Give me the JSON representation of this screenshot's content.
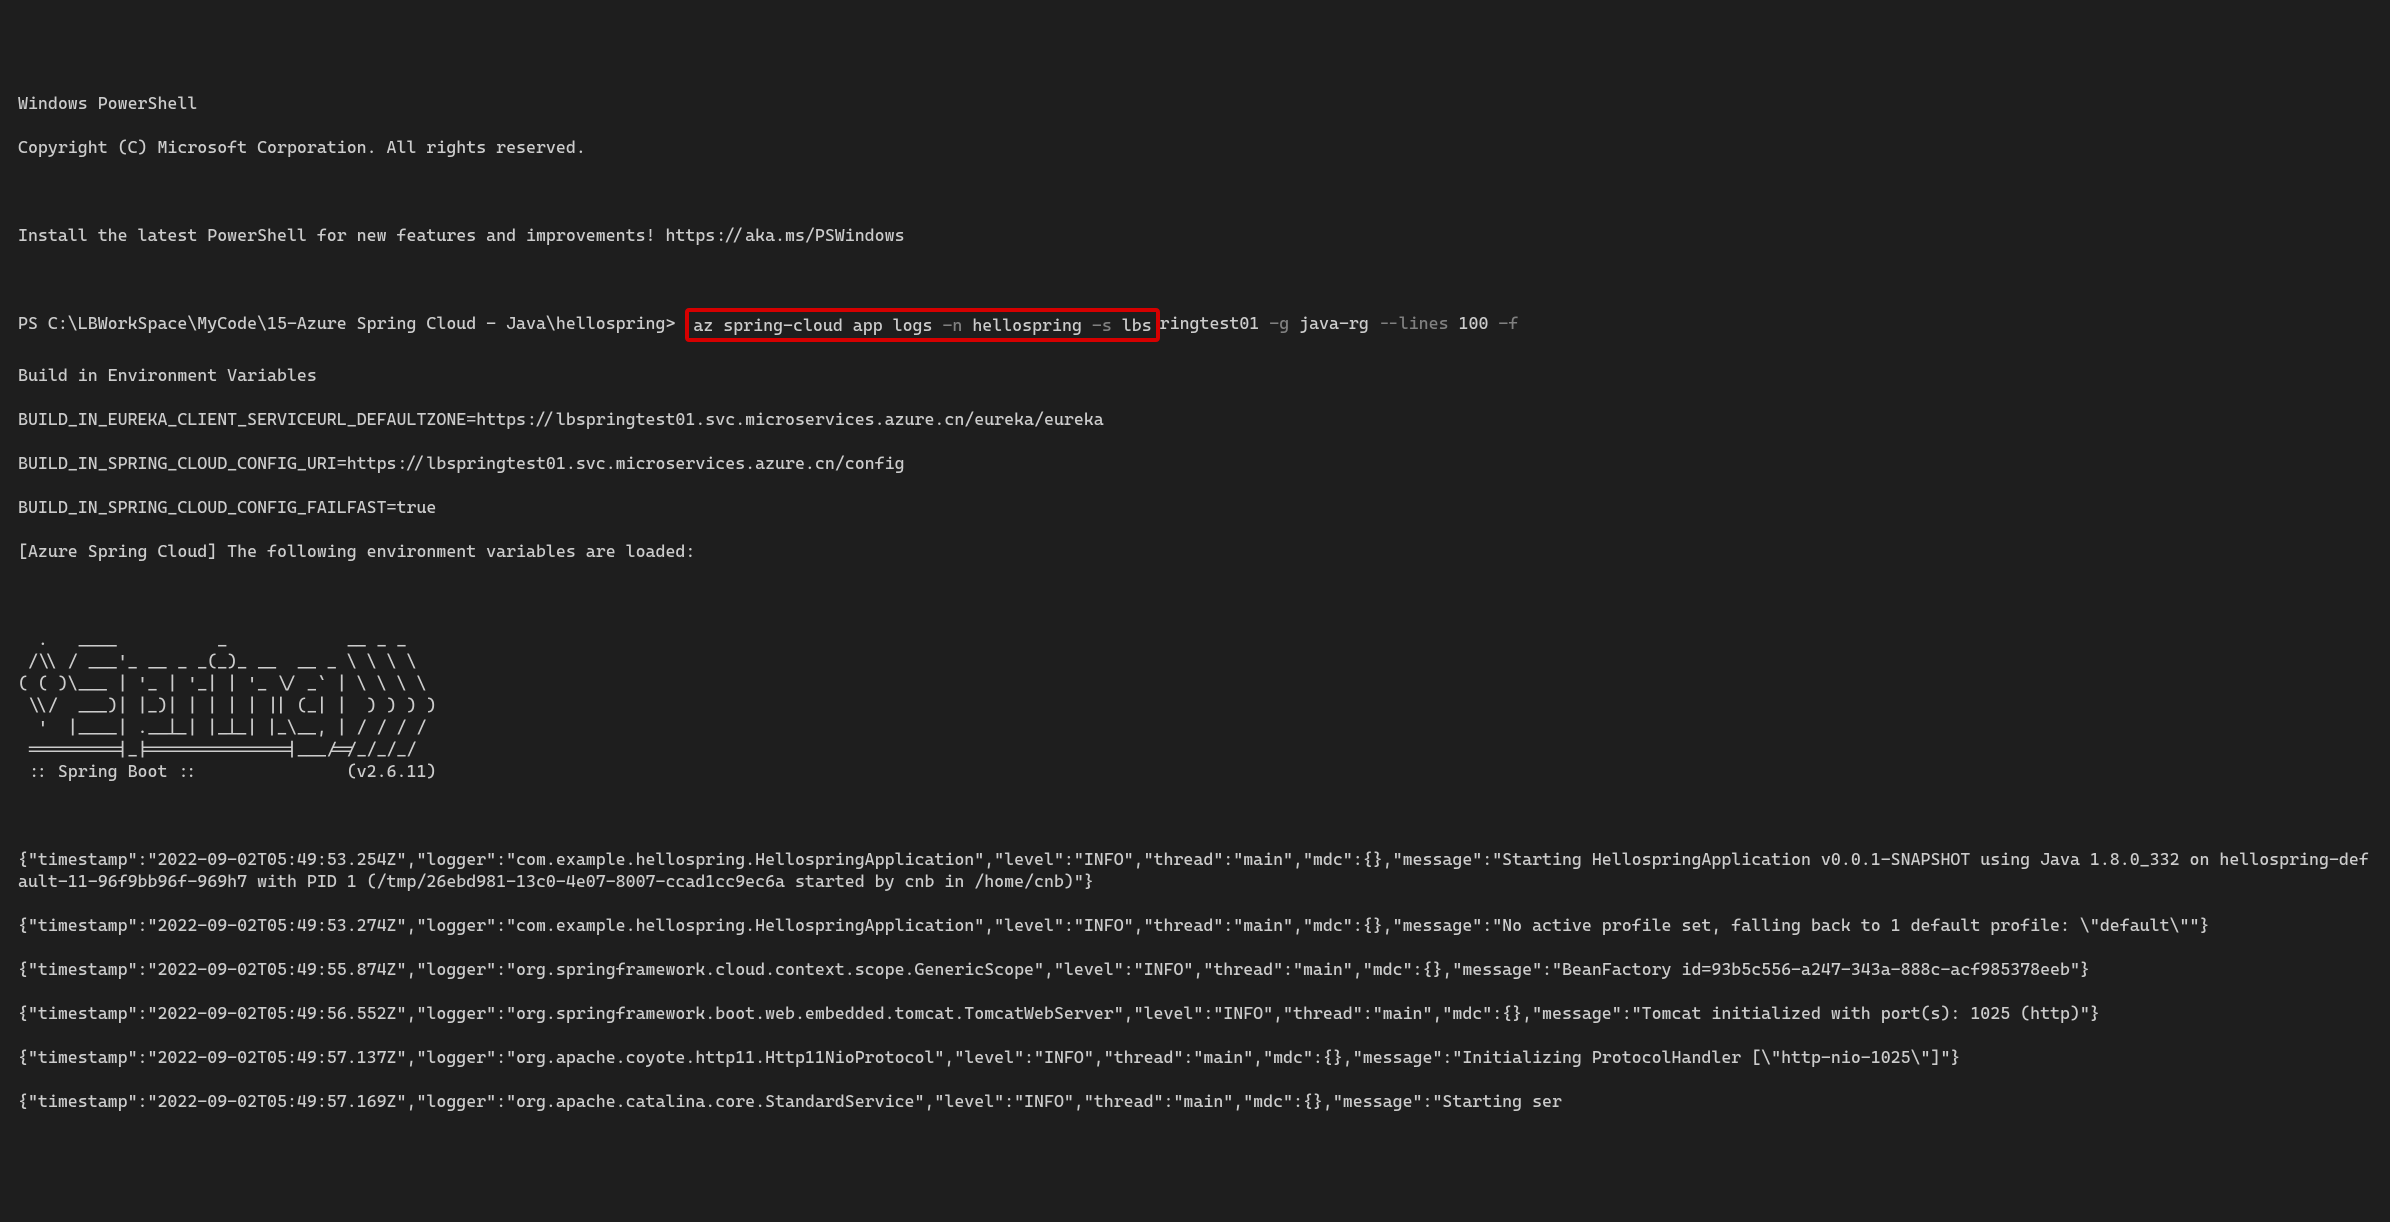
{
  "header": {
    "title": "Windows PowerShell",
    "copyright": "Copyright (C) Microsoft Corporation. All rights reserved.",
    "hint": "Install the latest PowerShell for new features and improvements! https://aka.ms/PSWindows"
  },
  "prompt": {
    "prefix": "PS C:\\LBWorkSpace\\MyCode\\15-Azure Spring Cloud - Java\\hellospring>",
    "cmd_az": "az",
    "cmd_rest": "spring-cloud app logs",
    "flag_n": "-n",
    "val_n": "hellospring",
    "flag_s": "-s",
    "val_s": "lbs",
    "tail_val_s": "ringtest01",
    "flag_g": "-g",
    "val_g": "java-rg",
    "flag_lines": "--lines",
    "val_lines": "100",
    "flag_f": "-f"
  },
  "env": {
    "title": "Build in Environment Variables",
    "eureka": "BUILD_IN_EUREKA_CLIENT_SERVICEURL_DEFAULTZONE=https://lbspringtest01.svc.microservices.azure.cn/eureka/eureka",
    "config_uri": "BUILD_IN_SPRING_CLOUD_CONFIG_URI=https://lbspringtest01.svc.microservices.azure.cn/config",
    "failfast": "BUILD_IN_SPRING_CLOUD_CONFIG_FAILFAST=true",
    "loaded": "[Azure Spring Cloud] The following environment variables are loaded:"
  },
  "banner": "  .   ____          _            __ _ _\n /\\\\ / ___'_ __ _ _(_)_ __  __ _ \\ \\ \\ \\\n( ( )\\___ | '_ | '_| | '_ \\/ _` | \\ \\ \\ \\\n \\\\/  ___)| |_)| | | | | || (_| |  ) ) ) )\n  '  |____| .__|_| |_|_| |_\\__, | / / / /\n =========|_|==============|___/=/_/_/_/\n :: Spring Boot ::               (v2.6.11)",
  "logs": {
    "l1": "{\"timestamp\":\"2022-09-02T05:49:53.254Z\",\"logger\":\"com.example.hellospring.HellospringApplication\",\"level\":\"INFO\",\"thread\":\"main\",\"mdc\":{},\"message\":\"Starting HellospringApplication v0.0.1-SNAPSHOT using Java 1.8.0_332 on hellospring-default-11-96f9bb96f-969h7 with PID 1 (/tmp/26ebd981-13c0-4e07-8007-ccad1cc9ec6a started by cnb in /home/cnb)\"}",
    "l2": "{\"timestamp\":\"2022-09-02T05:49:53.274Z\",\"logger\":\"com.example.hellospring.HellospringApplication\",\"level\":\"INFO\",\"thread\":\"main\",\"mdc\":{},\"message\":\"No active profile set, falling back to 1 default profile: \\\"default\\\"\"}",
    "l3": "{\"timestamp\":\"2022-09-02T05:49:55.874Z\",\"logger\":\"org.springframework.cloud.context.scope.GenericScope\",\"level\":\"INFO\",\"thread\":\"main\",\"mdc\":{},\"message\":\"BeanFactory id=93b5c556-a247-343a-888c-acf985378eeb\"}",
    "l4": "{\"timestamp\":\"2022-09-02T05:49:56.552Z\",\"logger\":\"org.springframework.boot.web.embedded.tomcat.TomcatWebServer\",\"level\":\"INFO\",\"thread\":\"main\",\"mdc\":{},\"message\":\"Tomcat initialized with port(s): 1025 (http)\"}",
    "l5": "{\"timestamp\":\"2022-09-02T05:49:57.137Z\",\"logger\":\"org.apache.coyote.http11.Http11NioProtocol\",\"level\":\"INFO\",\"thread\":\"main\",\"mdc\":{},\"message\":\"Initializing ProtocolHandler [\\\"http-nio-1025\\\"]\"}",
    "l6": "{\"timestamp\":\"2022-09-02T05:49:57.169Z\",\"logger\":\"org.apache.catalina.core.StandardService\",\"level\":\"INFO\",\"thread\":\"main\",\"mdc\":{},\"message\":\"Starting ser"
  }
}
